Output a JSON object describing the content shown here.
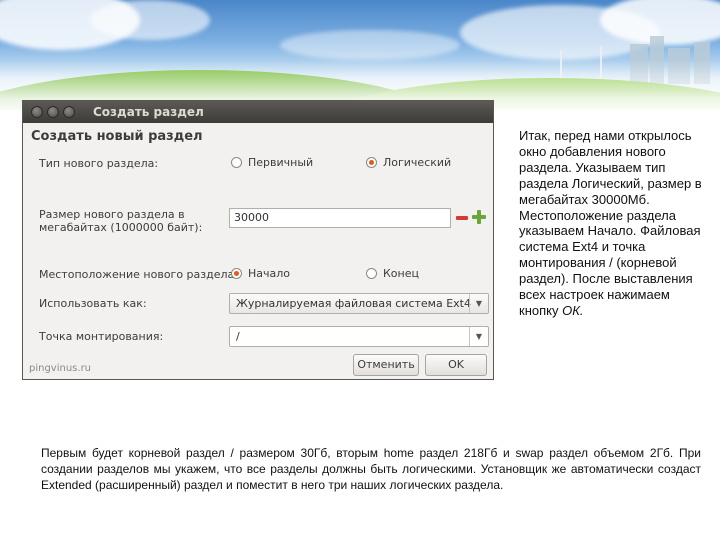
{
  "dialog": {
    "title": "Создать раздел",
    "heading": "Создать новый раздел",
    "partition_type": {
      "label": "Тип нового раздела:",
      "options": [
        {
          "label": "Первичный",
          "selected": false
        },
        {
          "label": "Логический",
          "selected": true
        }
      ]
    },
    "size": {
      "label_line1": "Размер нового раздела в",
      "label_line2": "мегабайтах (1000000 байт):",
      "value": "30000"
    },
    "location": {
      "label": "Местоположение нового раздела:",
      "options": [
        {
          "label": "Начало",
          "selected": true
        },
        {
          "label": "Конец",
          "selected": false
        }
      ]
    },
    "use_as": {
      "label": "Использовать как:",
      "value": "Журналируемая файловая система Ext4"
    },
    "mount_point": {
      "label": "Точка монтирования:",
      "value": "/"
    },
    "buttons": {
      "cancel": "Отменить",
      "ok": "OK"
    },
    "watermark": "pingvinus.ru"
  },
  "side_text": {
    "main": "Итак, перед нами открылось окно добавления нового раздела. Указываем тип раздела Логический, размер в мегабайтах 30000Мб. Местоположение раздела указываем Начало. Файловая система Ext4 и точка монтирования / (корневой раздел). После выставления всех настроек нажимаем кнопку ",
    "emphasis": "ОК."
  },
  "bottom_text": "Первым будет корневой раздел / размером 30Гб, вторым home раздел 218Гб и swap раздел объемом 2Гб. При создании разделов мы укажем, что все разделы должны быть логическими. Установщик же автоматически создаст Extended (расширенный) раздел и поместит в него три наших логических раздела.",
  "colors": {
    "radio_selected": "#e05b1c",
    "spin_minus": "#d43a3a",
    "spin_plus": "#6aa53c",
    "titlebar": "#3c3b37"
  }
}
